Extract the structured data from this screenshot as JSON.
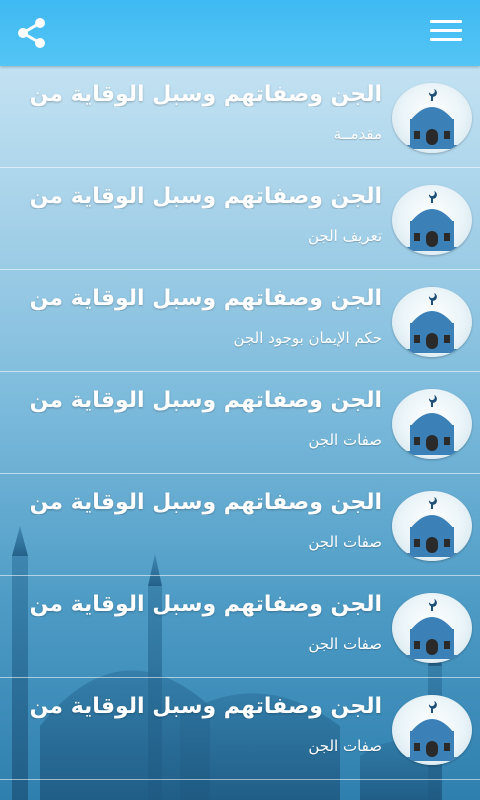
{
  "header": {
    "share_icon": "share-icon",
    "menu_icon": "hamburger-menu-icon",
    "background_color": "#4fc3f7"
  },
  "list": {
    "items": [
      {
        "title": "الجن وصفاتهم وسبل الوقاية من",
        "subtitle": "مقدمــة",
        "icon": "mosque-icon"
      },
      {
        "title": "الجن وصفاتهم وسبل الوقاية من",
        "subtitle": "تعريف الجن",
        "icon": "mosque-icon"
      },
      {
        "title": "الجن وصفاتهم وسبل الوقاية من",
        "subtitle": "حكم الإيمان بوجود الجن",
        "icon": "mosque-icon"
      },
      {
        "title": "الجن وصفاتهم وسبل الوقاية من",
        "subtitle": "صفات الجن",
        "icon": "mosque-icon"
      },
      {
        "title": "الجن وصفاتهم وسبل الوقاية من",
        "subtitle": "صفات الجن",
        "icon": "mosque-icon"
      },
      {
        "title": "الجن وصفاتهم وسبل الوقاية من",
        "subtitle": "صفات الجن",
        "icon": "mosque-icon"
      },
      {
        "title": "الجن وصفاتهم وسبل الوقاية من",
        "subtitle": "صفات الجن",
        "icon": "mosque-icon"
      }
    ]
  }
}
